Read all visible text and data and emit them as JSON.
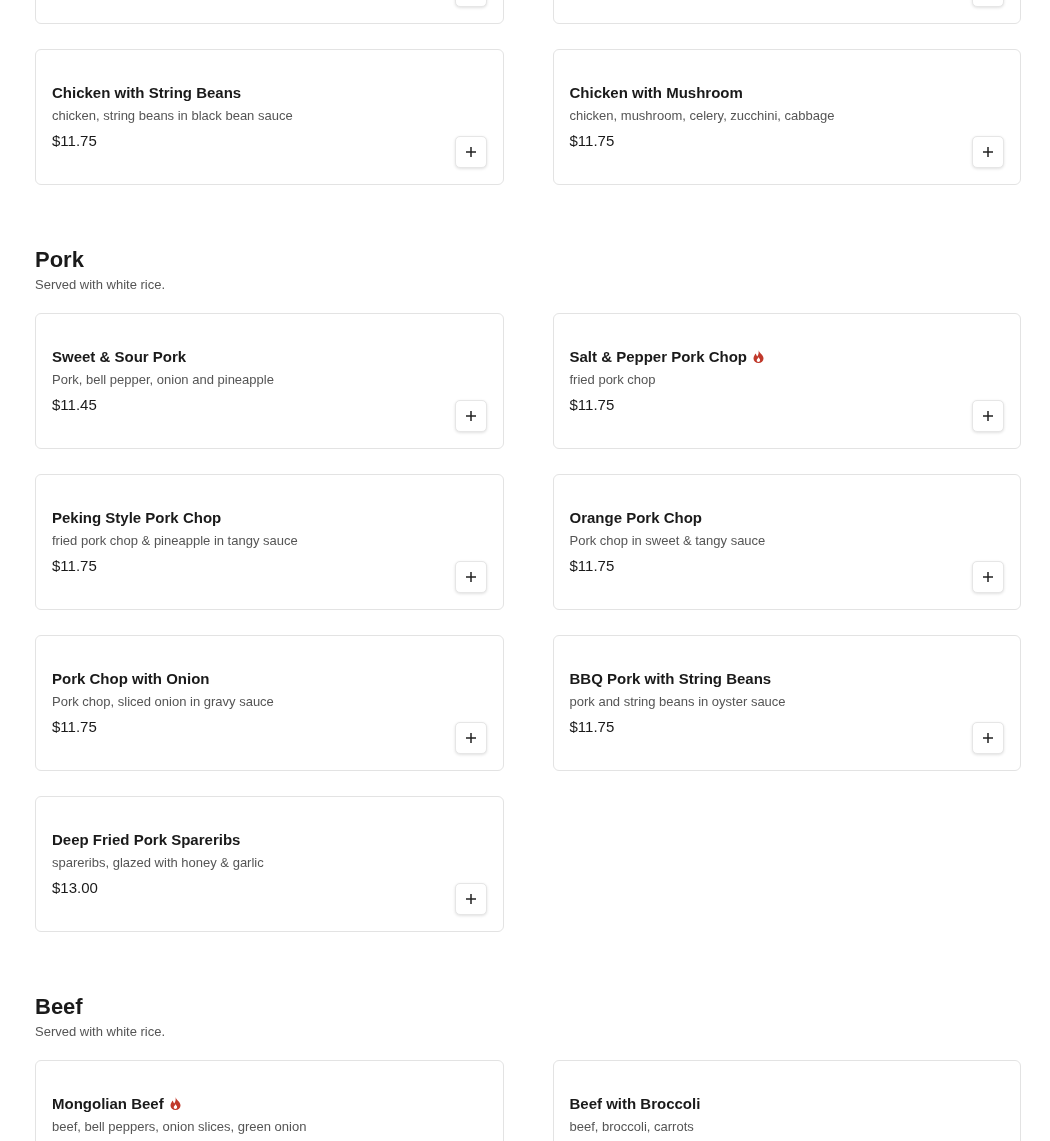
{
  "sections": [
    {
      "items": [
        {
          "kind": "clipped"
        },
        {
          "kind": "clipped"
        },
        {
          "kind": "item",
          "name": "Chicken with String Beans",
          "spicy": false,
          "description": "chicken, string beans in black bean sauce",
          "price": "$11.75"
        },
        {
          "kind": "item",
          "name": "Chicken with Mushroom",
          "spicy": false,
          "description": "chicken, mushroom, celery, zucchini, cabbage",
          "price": "$11.75"
        }
      ]
    },
    {
      "title": "Pork",
      "subtitle": "Served with white rice.",
      "items": [
        {
          "kind": "item",
          "name": "Sweet & Sour Pork",
          "spicy": false,
          "description": "Pork, bell pepper, onion and pineapple",
          "price": "$11.45"
        },
        {
          "kind": "item",
          "name": "Salt & Pepper Pork Chop",
          "spicy": true,
          "description": "fried pork chop",
          "price": "$11.75"
        },
        {
          "kind": "item",
          "name": "Peking Style Pork Chop",
          "spicy": false,
          "description": "fried pork chop & pineapple in tangy sauce",
          "price": "$11.75"
        },
        {
          "kind": "item",
          "name": "Orange Pork Chop",
          "spicy": false,
          "description": "Pork chop in sweet & tangy sauce",
          "price": "$11.75"
        },
        {
          "kind": "item",
          "name": "Pork Chop with Onion",
          "spicy": false,
          "description": "Pork chop, sliced onion in gravy sauce",
          "price": "$11.75"
        },
        {
          "kind": "item",
          "name": "BBQ Pork with String Beans",
          "spicy": false,
          "description": "pork and string beans in oyster sauce",
          "price": "$11.75"
        },
        {
          "kind": "item",
          "name": "Deep Fried Pork Spareribs",
          "spicy": false,
          "description": "spareribs, glazed with honey & garlic",
          "price": "$13.00"
        }
      ]
    },
    {
      "title": "Beef",
      "subtitle": "Served with white rice.",
      "items": [
        {
          "kind": "item",
          "name": "Mongolian Beef",
          "spicy": true,
          "description": "beef, bell peppers, onion slices, green onion"
        },
        {
          "kind": "item",
          "name": "Beef with Broccoli",
          "spicy": false,
          "description": "beef, broccoli, carrots"
        }
      ]
    }
  ]
}
